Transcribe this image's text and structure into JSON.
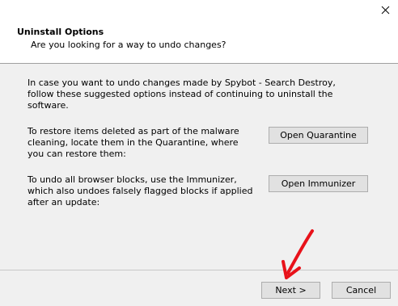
{
  "header": {
    "title": "Uninstall Options",
    "subtitle": "Are you looking for a way to undo changes?"
  },
  "close_icon": "close-icon",
  "content": {
    "intro": "In case you want to undo changes made by Spybot - Search Destroy, follow these suggested options instead of continuing to uninstall the software.",
    "quarantine_text": "To restore items deleted as part of the malware cleaning, locate them in the Quarantine, where you can restore them:",
    "quarantine_button": "Open Quarantine",
    "immunizer_text": "To undo all browser blocks, use the Immunizer, which also undoes falsely flagged blocks if applied after an update:",
    "immunizer_button": "Open Immunizer"
  },
  "footer": {
    "next_button": "Next >",
    "cancel_button": "Cancel"
  },
  "colors": {
    "annotation_arrow": "#e8121a"
  }
}
